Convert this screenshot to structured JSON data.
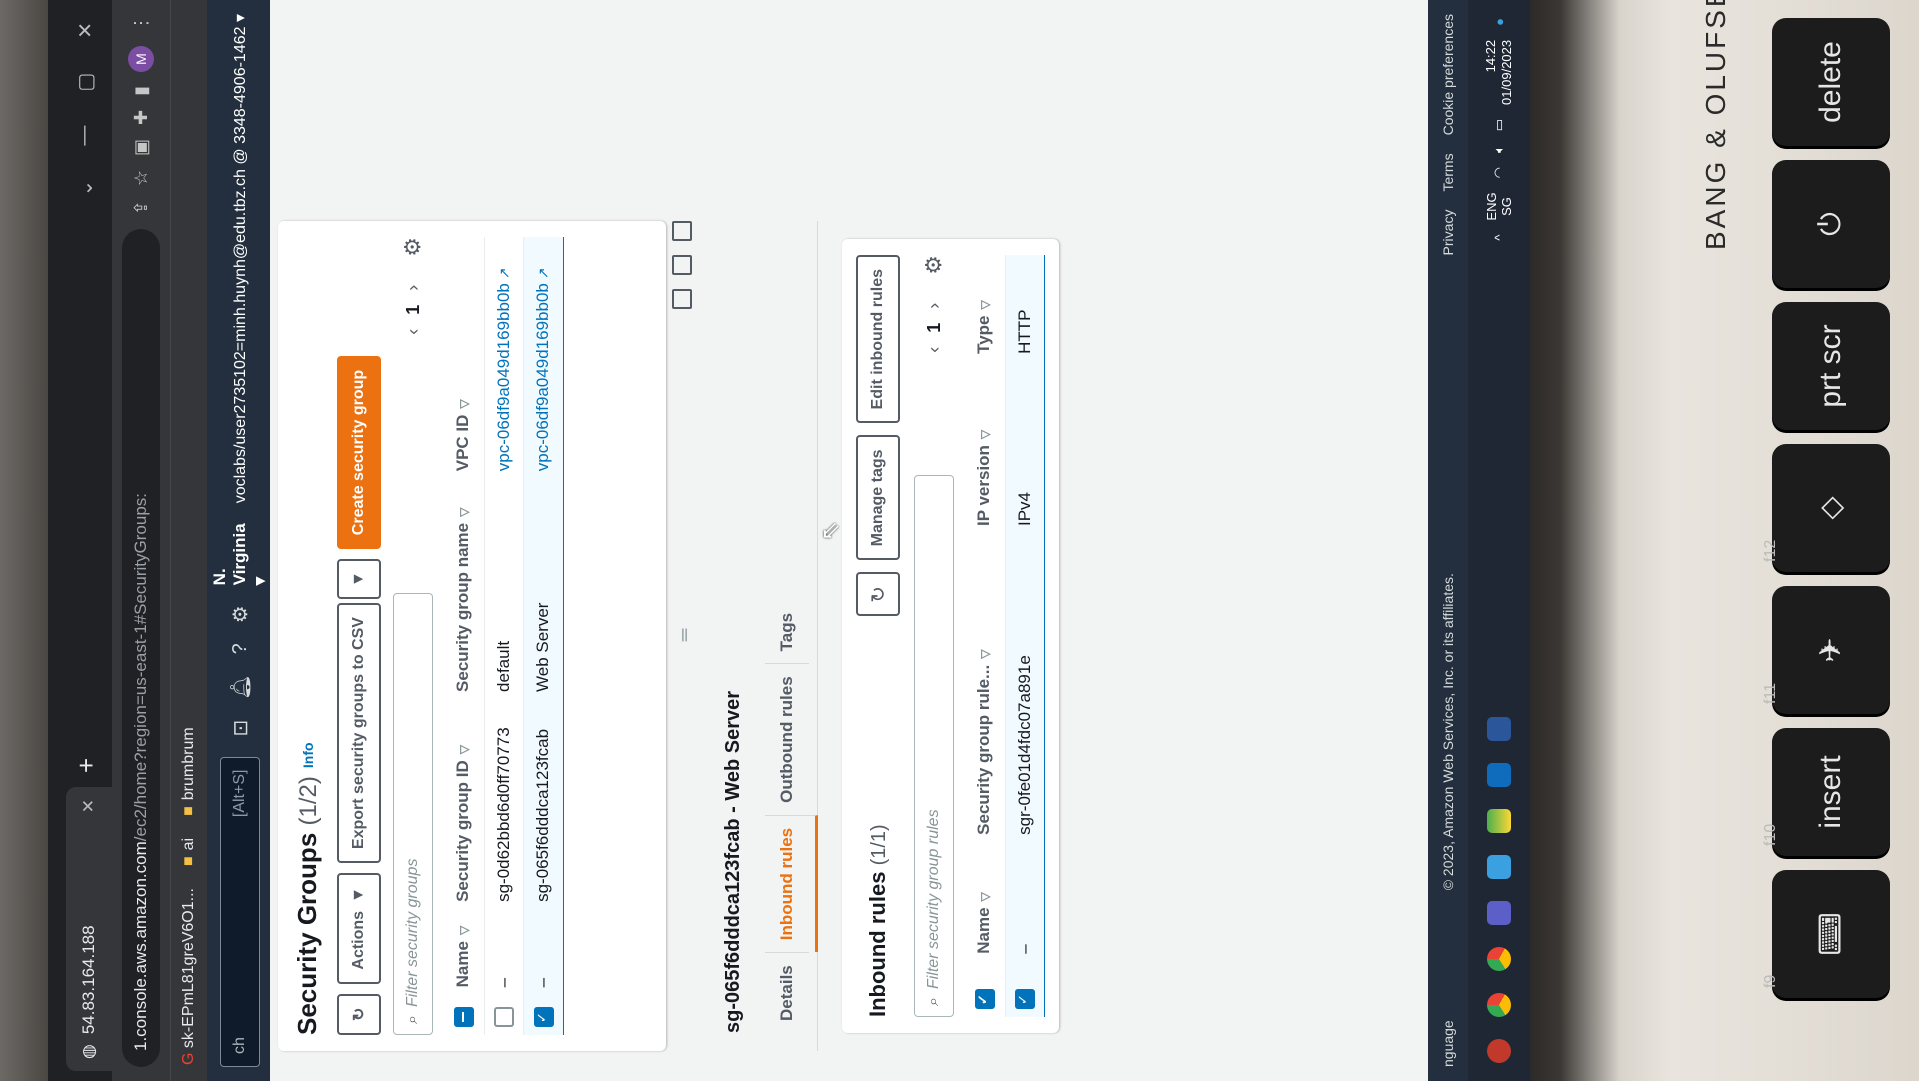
{
  "browser": {
    "tab_title": "54.83.164.188",
    "url_host": "1.console.aws.amazon.com",
    "url_path": "/ec2/home?region=us-east-1#SecurityGroups:",
    "bookmarks": [
      "sk-EPmL81greV6O1...",
      "ai",
      "brumbrum"
    ]
  },
  "aws_nav": {
    "search_shortcut": "[Alt+S]",
    "search_prefix": "ch",
    "region": "N. Virginia ▾",
    "account": "voclabs/user2735102=minh.huynh@edu.tbz.ch @ 3348-4906-1462 ▾"
  },
  "security_groups": {
    "title": "Security Groups",
    "count": "(1/2)",
    "info": "Info",
    "actions_label": "Actions",
    "export_label": "Export security groups to CSV",
    "create_label": "Create security group",
    "filter_placeholder": "Filter security groups",
    "page": "1",
    "columns": [
      "Name",
      "Security group ID",
      "Security group name",
      "VPC ID"
    ],
    "rows": [
      {
        "name": "–",
        "id": "sg-0d62bbd6d0ff70773",
        "group_name": "default",
        "vpc": "vpc-06df9a049d169bb0b",
        "selected": false
      },
      {
        "name": "–",
        "id": "sg-065f6dddca123fcab",
        "group_name": "Web Server",
        "vpc": "vpc-06df9a049d169bb0b",
        "selected": true
      }
    ]
  },
  "detail": {
    "title": "sg-065f6dddca123fcab - Web Server",
    "tabs": [
      "Details",
      "Inbound rules",
      "Outbound rules",
      "Tags"
    ],
    "active_tab": "Inbound rules"
  },
  "inbound_rules": {
    "title": "Inbound rules",
    "count": "(1/1)",
    "manage_tags_label": "Manage tags",
    "edit_label": "Edit inbound rules",
    "filter_placeholder": "Filter security group rules",
    "page": "1",
    "columns": [
      "Name",
      "Security group rule...",
      "IP version",
      "Type"
    ],
    "rows": [
      {
        "name": "–",
        "rule_id": "sgr-0fe01d4fdc07a891e",
        "ip_version": "IPv4",
        "type": "HTTP"
      }
    ]
  },
  "footer": {
    "language": "nguage",
    "copyright": "© 2023, Amazon Web Services, Inc. or its affiliates.",
    "links": [
      "Privacy",
      "Terms",
      "Cookie preferences"
    ]
  },
  "taskbar": {
    "lang": "ENG",
    "lang_sub": "SG",
    "time": "14:22",
    "date": "01/09/2023"
  },
  "keyboard": {
    "brand": "BANG & OLUFSEN",
    "keys": [
      {
        "label": "delete",
        "fn": ""
      },
      {
        "label": "⏻",
        "fn": ""
      },
      {
        "label": "prt scr",
        "fn": ""
      },
      {
        "label": "◇",
        "fn": "f12"
      },
      {
        "label": "✈",
        "fn": "f11"
      },
      {
        "label": "insert",
        "fn": "f10"
      },
      {
        "label": "⌨",
        "fn": "f9"
      }
    ]
  },
  "colors": {
    "aws_nav": "#232f3e",
    "primary": "#ec7211",
    "link": "#0073bb"
  }
}
